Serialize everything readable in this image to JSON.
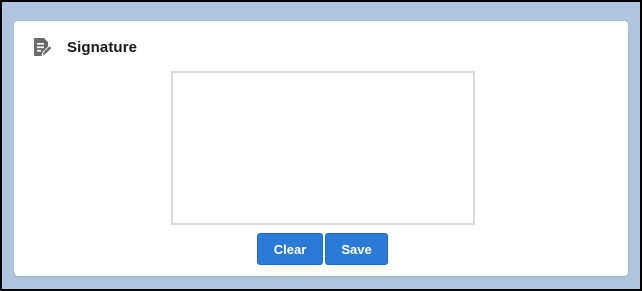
{
  "card": {
    "title": "Signature",
    "icon": "signature-document-icon"
  },
  "actions": {
    "clear_label": "Clear",
    "save_label": "Save"
  },
  "colors": {
    "background": "#b0c4de",
    "card": "#ffffff",
    "button": "#2b7bd6",
    "button_text": "#ffffff",
    "pad_border": "#dddbda",
    "icon": "#6b6b6b"
  }
}
